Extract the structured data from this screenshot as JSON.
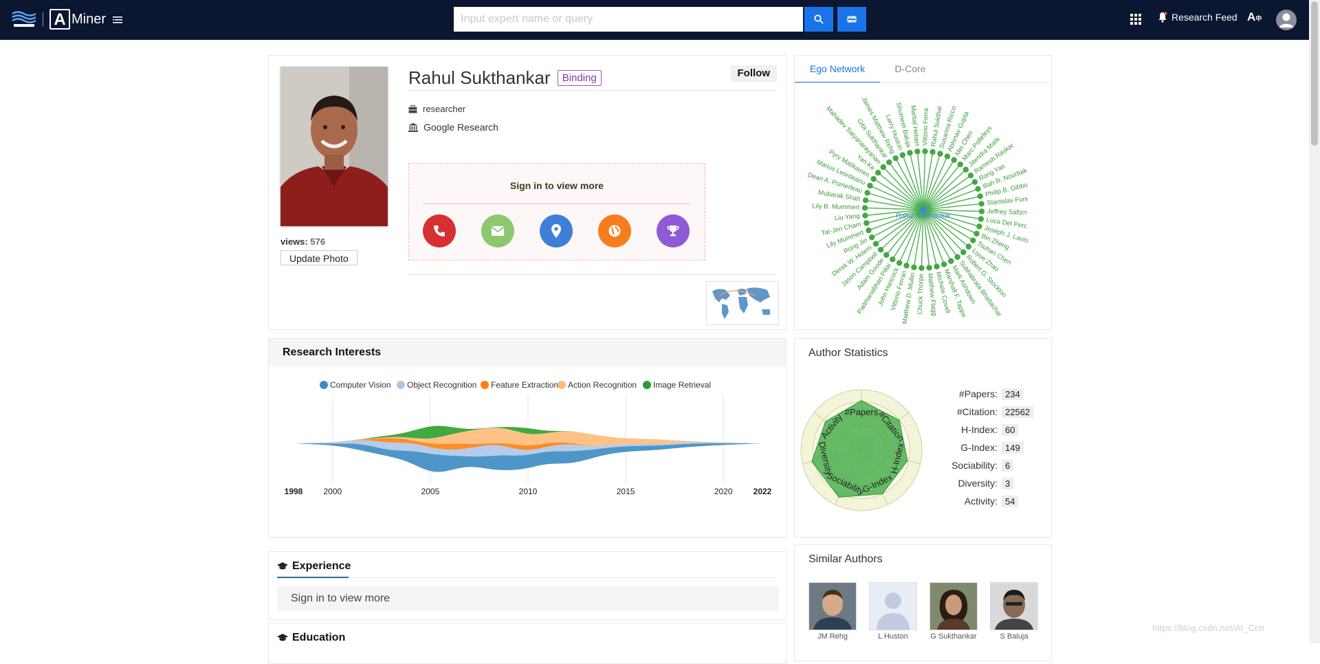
{
  "header": {
    "logo_text": "Miner",
    "logo_letter": "A",
    "search_placeholder": "Input expert name or query",
    "research_feed": "Research Feed",
    "lang_icon": "A"
  },
  "profile": {
    "name": "Rahul Sukthankar",
    "binding": "Binding",
    "follow": "Follow",
    "views_label": "views:",
    "views_value": "576",
    "update_photo": "Update Photo",
    "position": "researcher",
    "affiliation": "Google Research",
    "signin_text": "Sign in to view more",
    "contact_colors": [
      "#d63031",
      "#8dc86f",
      "#3f7fd6",
      "#f57d1f",
      "#8e5ad6"
    ]
  },
  "ego": {
    "tab_active": "Ego Network",
    "tab_inactive": "D-Core",
    "center_label": "Rahul Sukthankar",
    "names": [
      "Vittorio Ferra",
      "Rahul Sukthal",
      "Susanna Ricco",
      "Abhinav Gupta",
      "Mei Chen",
      "Marc Pollefeys",
      "Jitendra Malik",
      "Ramesh Raskar",
      "Rong Yan",
      "Illah R. Nourbak",
      "Philip B. Gibbo",
      "Stanislav Funi",
      "Jeffrey Saltzn",
      "Luca Del Perc",
      "Joseph J. Lavio",
      "Bin Zheng",
      "Tsuhan Chen",
      "Liyue Zhao",
      "Robert G. Stockton",
      "Subhabrata Bhattachar",
      "Mark Ashdown",
      "Marshall F. Tappe",
      "Michele Covell",
      "Matthew Flagg",
      "Chuck Thorpe",
      "Matthew D. Mullin",
      "Vittorio Ferrari",
      "John Hancock",
      "Padmanabhan Pillai",
      "Adam Goode",
      "Jason Campbell",
      "Derek W. Hoiem",
      "Rong Jin",
      "Lily Mummert",
      "Tat-Jen Cham",
      "Liu Yang",
      "Lily B. Mummert",
      "Mubarak Shah",
      "Dean A. Pomerleau",
      "Marius Leordeanu",
      "Pyry Matikainen",
      "Yan Ke",
      "Mahadev Satyanarayanan",
      "Gita Sukthankar",
      "James Matthew Rehg",
      "Larry Huston",
      "Shumeet Baluja",
      "Martial Hebert"
    ]
  },
  "research": {
    "title": "Research Interests",
    "chart_data": {
      "type": "area",
      "x": [
        1998,
        2000,
        2005,
        2010,
        2015,
        2020,
        2022
      ],
      "tick_labels": [
        "1998",
        "2000",
        "2005",
        "2010",
        "2015",
        "2020",
        "2022"
      ],
      "series": [
        {
          "name": "Computer Vision",
          "color": "#3b8bc2"
        },
        {
          "name": "Object Recognition",
          "color": "#aec7e8"
        },
        {
          "name": "Feature Extraction",
          "color": "#ff7f0e"
        },
        {
          "name": "Action Recognition",
          "color": "#ffbb78"
        },
        {
          "name": "Image Retrieval",
          "color": "#2ca02c"
        }
      ],
      "grid": true,
      "legend": "top"
    }
  },
  "stats": {
    "title": "Author Statistics",
    "rows": [
      {
        "label": "#Papers:",
        "value": "234"
      },
      {
        "label": "#Citation:",
        "value": "22562"
      },
      {
        "label": "H-Index:",
        "value": "60"
      },
      {
        "label": "G-Index:",
        "value": "149"
      },
      {
        "label": "Sociability:",
        "value": "6"
      },
      {
        "label": "Diversity:",
        "value": "3"
      },
      {
        "label": "Activity:",
        "value": "54"
      }
    ],
    "radar_axes": [
      "#Papers",
      "#Citation",
      "H-Index",
      "G-Index",
      "Sociability",
      "Diversity",
      "Activity"
    ],
    "radar_color": "#4caf50"
  },
  "experience": {
    "title": "Experience",
    "signin": "Sign in to view more"
  },
  "education": {
    "title": "Education"
  },
  "similar": {
    "title": "Similar Authors",
    "authors": [
      "JM Rehg",
      "L Huston",
      "G Sukthankar",
      "S Baluja"
    ]
  },
  "watermark": "https://blog.csdn.net/AI_Con"
}
